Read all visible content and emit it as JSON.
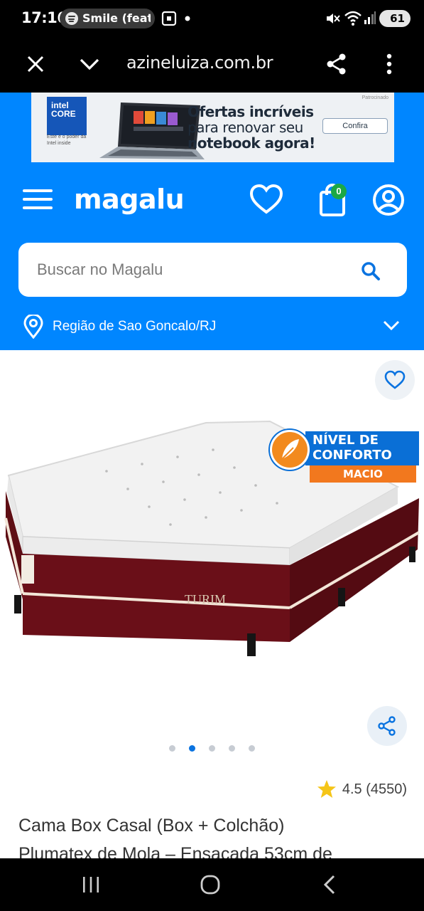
{
  "status_bar": {
    "time": "17:16",
    "media_label": "Smile (feat.",
    "battery": "61",
    "icons": [
      "spotify-icon",
      "screenshot-icon",
      "mute-icon",
      "wifi-icon",
      "signal-icon",
      "battery-icon"
    ]
  },
  "browser": {
    "url": "azineluiza.com.br",
    "icons": [
      "close-icon",
      "chevron-down-icon",
      "share-icon",
      "more-vert-icon"
    ]
  },
  "banner": {
    "brand_top": "intel",
    "brand_bottom": "CORE",
    "brand_tagline": "Este é o poder da Intel inside",
    "title_line1": "Ofertas incríveis",
    "title_line2": "para renovar seu",
    "title_line3": "notebook agora!",
    "cta": "Confira",
    "tag": "Patrocinado"
  },
  "header": {
    "logo": "magalu",
    "cart_count": "0",
    "colors": {
      "brand_blue": "#0086ff",
      "cart_badge": "#1ca845"
    }
  },
  "search": {
    "placeholder": "Buscar no Magalu",
    "value": ""
  },
  "region": {
    "label": "Região de Sao Goncalo/RJ"
  },
  "product": {
    "image_brand": "TURIM",
    "badge_line1": "NÍVEL DE",
    "badge_line2": "CONFORTO",
    "badge_level": "MACIO",
    "carousel_total": 5,
    "carousel_active": 2,
    "rating": "4.5 (4550)",
    "title_line1": "Cama Box Casal (Box + Colchão)",
    "title_line2": "Plumatex de Mola – Ensacada 53cm de"
  }
}
